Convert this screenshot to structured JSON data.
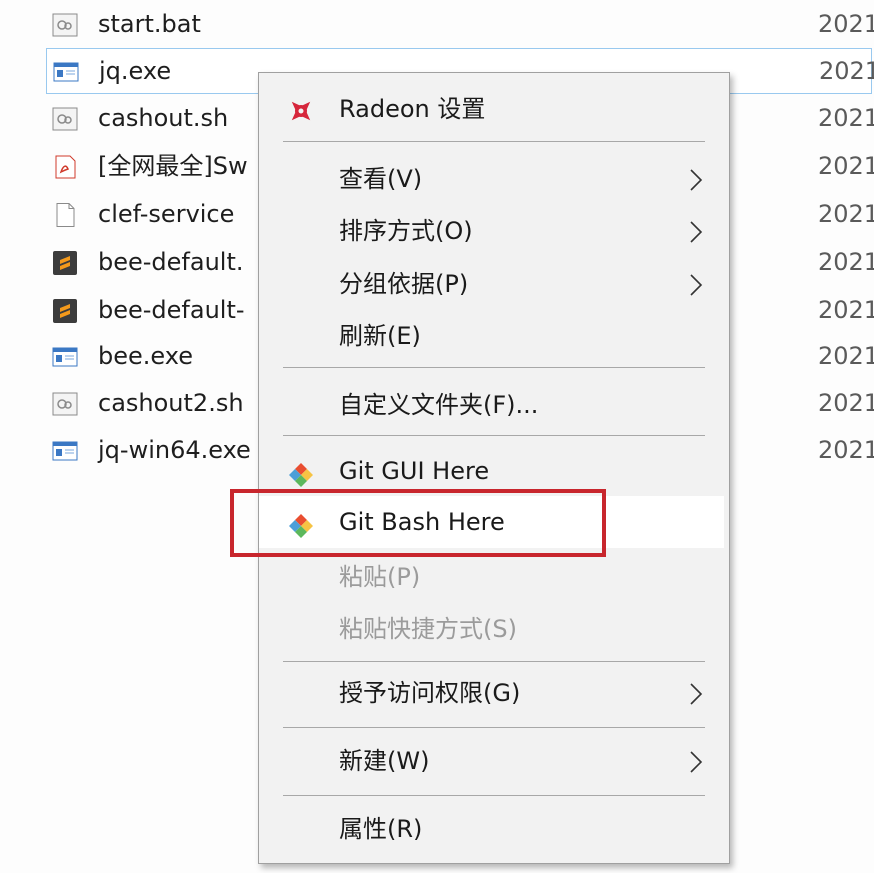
{
  "files": [
    {
      "name": "start.bat",
      "date": "2021",
      "icon": "batch-file-icon"
    },
    {
      "name": "jq.exe",
      "date": "2021",
      "icon": "executable-icon",
      "selected": true
    },
    {
      "name": "cashout.sh",
      "date": "2021",
      "icon": "script-file-icon"
    },
    {
      "name": "[全网最全]Sw",
      "date": "2021",
      "icon": "pdf-file-icon"
    },
    {
      "name": "clef-service",
      "date": "2021",
      "icon": "blank-file-icon"
    },
    {
      "name": "bee-default.",
      "date": "2021",
      "icon": "sublime-file-icon"
    },
    {
      "name": "bee-default-",
      "date": "2021",
      "icon": "sublime-file-icon"
    },
    {
      "name": "bee.exe",
      "date": "2021",
      "icon": "executable-icon"
    },
    {
      "name": "cashout2.sh",
      "date": "2021",
      "icon": "script-file-icon"
    },
    {
      "name": "jq-win64.exe",
      "date": "2021",
      "icon": "executable-icon"
    }
  ],
  "context_menu": {
    "items": [
      {
        "label": "Radeon 设置",
        "icon": "radeon-icon",
        "submenu": false,
        "disabled": false
      },
      {
        "label": "查看(V)",
        "submenu": true,
        "disabled": false
      },
      {
        "label": "排序方式(O)",
        "submenu": true,
        "disabled": false
      },
      {
        "label": "分组依据(P)",
        "submenu": true,
        "disabled": false
      },
      {
        "label": "刷新(E)",
        "submenu": false,
        "disabled": false
      },
      {
        "label": "自定义文件夹(F)...",
        "submenu": false,
        "disabled": false
      },
      {
        "label": "Git GUI Here",
        "icon": "git-icon",
        "submenu": false,
        "disabled": false
      },
      {
        "label": "Git Bash Here",
        "icon": "git-icon",
        "submenu": false,
        "disabled": false,
        "hovered": true,
        "highlighted": true
      },
      {
        "label": "粘贴(P)",
        "submenu": false,
        "disabled": true
      },
      {
        "label": "粘贴快捷方式(S)",
        "submenu": false,
        "disabled": true
      },
      {
        "label": "授予访问权限(G)",
        "submenu": true,
        "disabled": false
      },
      {
        "label": "新建(W)",
        "submenu": true,
        "disabled": false
      },
      {
        "label": "属性(R)",
        "submenu": false,
        "disabled": false
      }
    ]
  },
  "colors": {
    "highlight_border": "#c8262d",
    "selection_border": "#99c9ef",
    "menu_background": "#f2f2f2",
    "disabled_text": "#9b9b9b"
  }
}
